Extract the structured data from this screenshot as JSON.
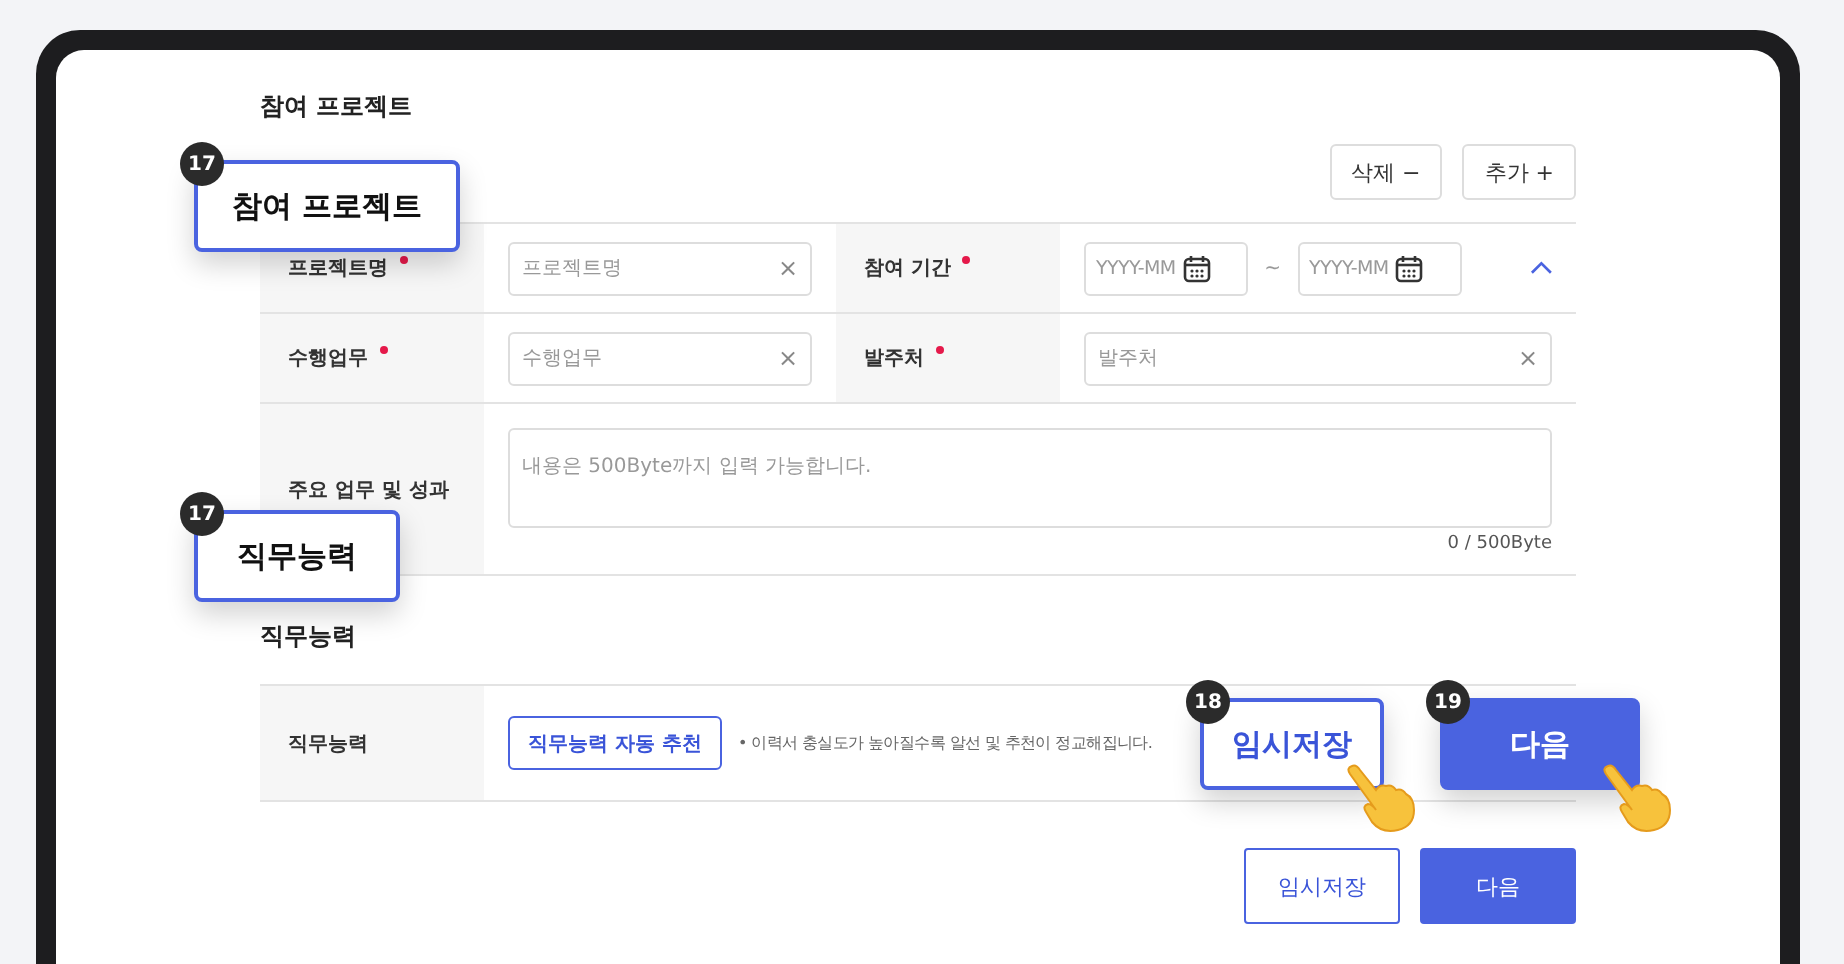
{
  "project_section": {
    "title": "참여 프로젝트",
    "actions": [
      {
        "label": "삭제",
        "symbol": "−"
      },
      {
        "label": "추가",
        "symbol": "+"
      }
    ],
    "rows": [
      {
        "fields": [
          {
            "kind": "text",
            "label": "프로젝트명",
            "required": true,
            "placeholder": "프로젝트명",
            "clear": "×"
          },
          {
            "kind": "date_range",
            "label": "참여 기간",
            "required": true,
            "from_placeholder": "YYYY-MM",
            "separator": "~",
            "to_placeholder": "YYYY-MM",
            "expanded": true
          }
        ]
      },
      {
        "fields": [
          {
            "kind": "text",
            "label": "수행업무",
            "required": true,
            "placeholder": "수행업무",
            "clear": "×"
          },
          {
            "kind": "text",
            "label": "발주처",
            "required": true,
            "placeholder": "발주처",
            "clear": "×"
          }
        ]
      },
      {
        "fields": [
          {
            "kind": "textarea",
            "label": "주요 업무 및 성과",
            "required": false,
            "placeholder": "내용은 500Byte까지 입력 가능합니다.",
            "counter": "0 / 500Byte"
          }
        ]
      }
    ]
  },
  "skills_section": {
    "title": "직무능력",
    "label": "직무능력",
    "button": "직무능력 자동 추천",
    "note": "• 이력서 충실도가 높아질수록 알선 및 추천이 정교해집니다."
  },
  "footer_buttons": [
    {
      "label": "임시저장",
      "kind": "outline"
    },
    {
      "label": "다음",
      "kind": "primary"
    }
  ],
  "callouts": [
    {
      "number": "17",
      "label": "참여 프로젝트",
      "kind": "outline",
      "pointer": false
    },
    {
      "number": "17",
      "label": "직무능력",
      "kind": "outline",
      "pointer": false
    },
    {
      "number": "18",
      "label": "임시저장",
      "kind": "outline",
      "pointer": true
    },
    {
      "number": "19",
      "label": "다음",
      "kind": "primary",
      "pointer": true
    }
  ]
}
